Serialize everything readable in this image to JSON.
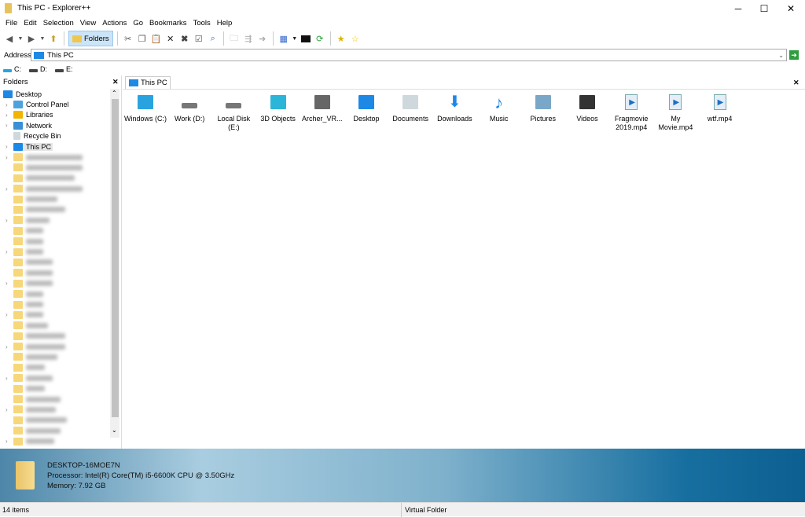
{
  "window": {
    "title": "This PC - Explorer++",
    "minimize": "─",
    "maximize": "☐",
    "close": "✕"
  },
  "menu": [
    "File",
    "Edit",
    "Selection",
    "View",
    "Actions",
    "Go",
    "Bookmarks",
    "Tools",
    "Help"
  ],
  "toolbar": {
    "folders_label": "Folders"
  },
  "address": {
    "label": "Address",
    "value": "This PC"
  },
  "drives": [
    "C:",
    "D:",
    "E:"
  ],
  "folders_pane": {
    "title": "Folders",
    "close": "✕",
    "items": [
      {
        "label": "Desktop"
      },
      {
        "label": "Control Panel"
      },
      {
        "label": "Libraries"
      },
      {
        "label": "Network"
      },
      {
        "label": "Recycle Bin"
      },
      {
        "label": "This PC"
      }
    ]
  },
  "tab": {
    "label": "This PC",
    "close": "✕"
  },
  "items": [
    {
      "name": "Windows (C:)",
      "icon": "windows-drive-icon"
    },
    {
      "name": "Work (D:)",
      "icon": "drive-icon"
    },
    {
      "name": "Local Disk (E:)",
      "icon": "drive-icon"
    },
    {
      "name": "3D Objects",
      "icon": "3d-objects-icon"
    },
    {
      "name": "Archer_VR...",
      "icon": "device-icon"
    },
    {
      "name": "Desktop",
      "icon": "desktop-icon"
    },
    {
      "name": "Documents",
      "icon": "documents-icon"
    },
    {
      "name": "Downloads",
      "icon": "downloads-icon"
    },
    {
      "name": "Music",
      "icon": "music-icon"
    },
    {
      "name": "Pictures",
      "icon": "pictures-icon"
    },
    {
      "name": "Videos",
      "icon": "videos-icon"
    },
    {
      "name": "Fragmovie 2019.mp4",
      "icon": "video-file-icon"
    },
    {
      "name": "My Movie.mp4",
      "icon": "video-file-icon"
    },
    {
      "name": "wtf.mp4",
      "icon": "video-file-icon"
    }
  ],
  "info": {
    "computer": "DESKTOP-16MOE7N",
    "processor": "Processor: Intel(R) Core(TM) i5-6600K CPU @ 3.50GHz",
    "memory": "Memory: 7.92 GB"
  },
  "status": {
    "count": "14 items",
    "type": "Virtual Folder"
  }
}
